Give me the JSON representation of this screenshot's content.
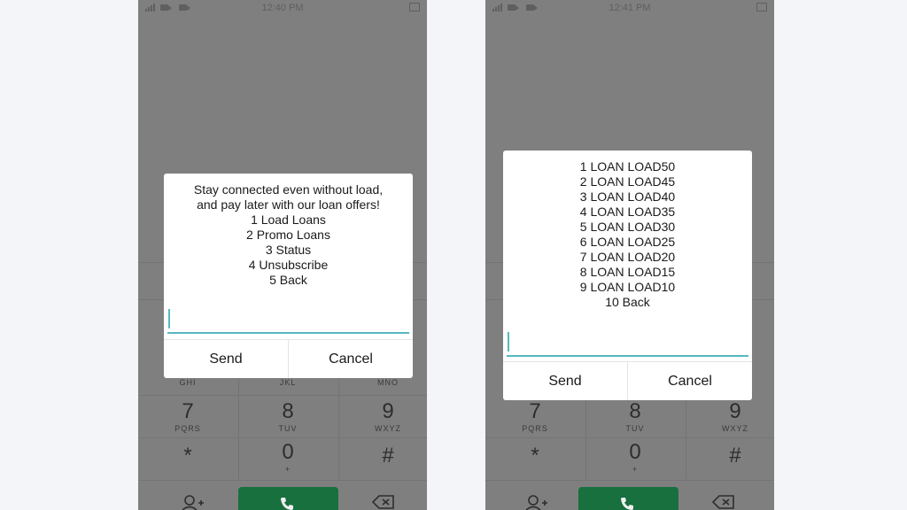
{
  "screens": [
    {
      "status": {
        "time": "12:40 PM"
      },
      "dialog": {
        "lines": [
          "Stay connected even without load,",
          "and pay later with our loan offers!",
          "1 Load Loans",
          "2 Promo Loans",
          "3 Status",
          "4 Unsubscribe",
          "5 Back"
        ],
        "input_value": "",
        "send_label": "Send",
        "cancel_label": "Cancel"
      },
      "dialpad": {
        "row3_letters": [
          "GHI",
          "JKL",
          "MNO"
        ],
        "row4": [
          {
            "digit": "7",
            "letters": "PQRS"
          },
          {
            "digit": "8",
            "letters": "TUV"
          },
          {
            "digit": "9",
            "letters": "WXYZ"
          }
        ],
        "row5": [
          {
            "digit": "*",
            "letters": ""
          },
          {
            "digit": "0",
            "letters": "+"
          },
          {
            "digit": "#",
            "letters": ""
          }
        ]
      }
    },
    {
      "status": {
        "time": "12:41 PM"
      },
      "dialog": {
        "lines": [
          "1 LOAN LOAD50",
          "2 LOAN LOAD45",
          "3 LOAN LOAD40",
          "4 LOAN LOAD35",
          "5 LOAN LOAD30",
          "6 LOAN LOAD25",
          "7 LOAN LOAD20",
          "8 LOAN LOAD15",
          "9 LOAN LOAD10",
          "10 Back"
        ],
        "input_value": "",
        "send_label": "Send",
        "cancel_label": "Cancel"
      },
      "dialpad": {
        "row4": [
          {
            "digit": "7",
            "letters": "PQRS"
          },
          {
            "digit": "8",
            "letters": "TUV"
          },
          {
            "digit": "9",
            "letters": "WXYZ"
          }
        ],
        "row5": [
          {
            "digit": "*",
            "letters": ""
          },
          {
            "digit": "0",
            "letters": "+"
          },
          {
            "digit": "#",
            "letters": ""
          }
        ]
      }
    }
  ],
  "icons": {
    "status": [
      "signal-icon",
      "video-icon",
      "battery-icon"
    ],
    "dialpad": [
      "add-contact-icon",
      "call-icon",
      "backspace-icon"
    ]
  },
  "colors": {
    "overlay": "#7f7f7f",
    "dialog": "#ffffff",
    "input_accent": "#56b8bf",
    "call_button": "#17703d"
  }
}
